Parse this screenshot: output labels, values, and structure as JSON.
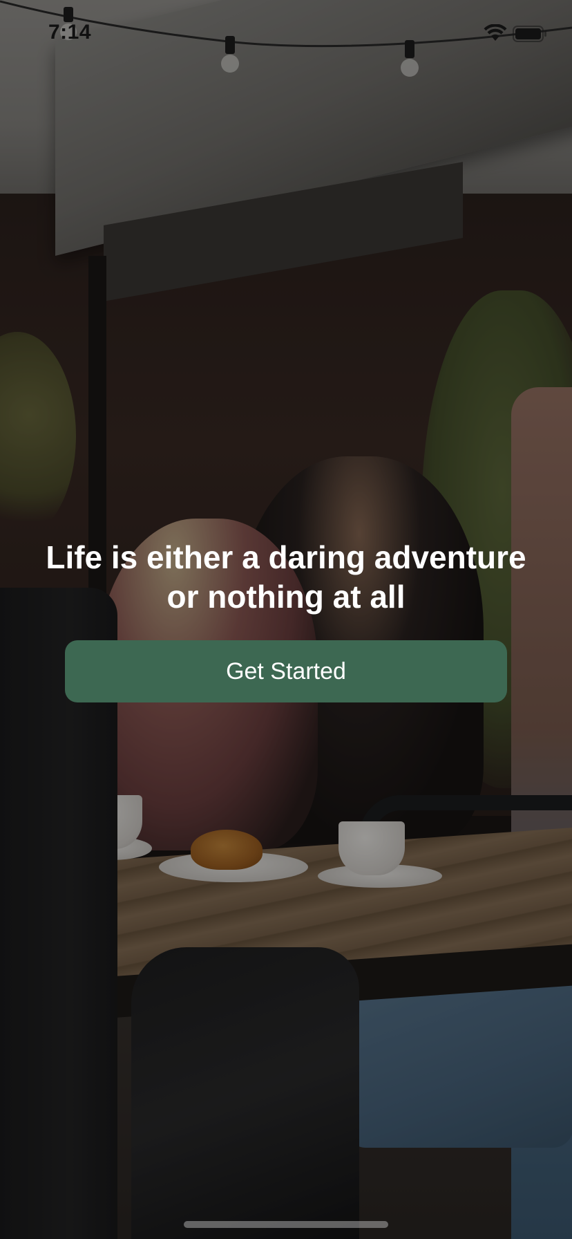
{
  "status_bar": {
    "time": "7:14"
  },
  "content": {
    "headline": "Life is either a daring adventure or nothing at all",
    "cta_label": "Get Started"
  },
  "colors": {
    "button_background": "#3d6852",
    "button_text": "#ffffff",
    "headline_text": "#ffffff",
    "status_text": "#111111"
  },
  "icons": {
    "wifi": "wifi-icon",
    "battery": "battery-icon"
  }
}
